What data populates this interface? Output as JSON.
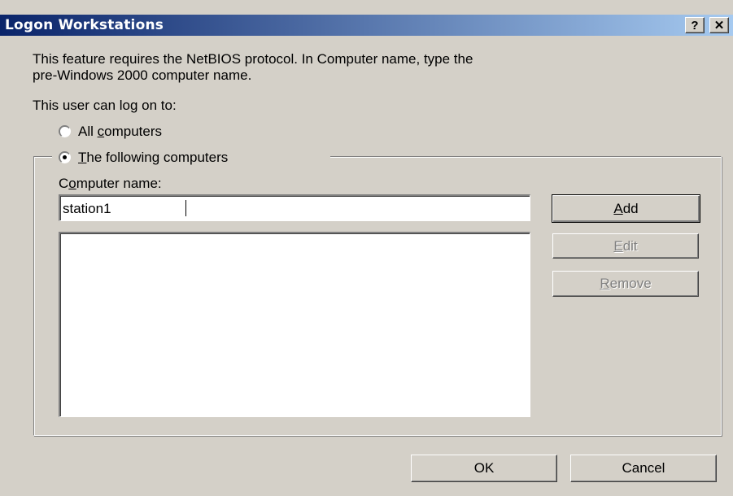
{
  "window": {
    "title": "Logon Workstations",
    "help_label": "?",
    "close_label": "✕",
    "colors": {
      "titlebar_start": "#0a246a",
      "titlebar_end": "#a6caf0",
      "face": "#d4d0c8"
    }
  },
  "description": {
    "line1": "This feature requires the NetBIOS protocol. In Computer name, type the",
    "line2": "pre-Windows 2000 computer name."
  },
  "logon_to_label": "This user can log on to:",
  "options": {
    "all_computers": {
      "pre": "All ",
      "mnemonic": "c",
      "post": "omputers",
      "selected": false
    },
    "following_computers": {
      "pre": "",
      "mnemonic": "T",
      "post": "he following computers",
      "selected": true
    }
  },
  "computer_name": {
    "label_pre": "C",
    "label_mnemonic": "o",
    "label_post": "mputer name:",
    "value": "station1"
  },
  "computer_list": [],
  "buttons": {
    "add": {
      "mnemonic": "A",
      "rest": "dd",
      "enabled": true
    },
    "edit": {
      "mnemonic": "E",
      "rest": "dit",
      "enabled": false
    },
    "remove": {
      "mnemonic": "R",
      "rest": "emove",
      "enabled": false
    },
    "ok": "OK",
    "cancel": "Cancel"
  }
}
